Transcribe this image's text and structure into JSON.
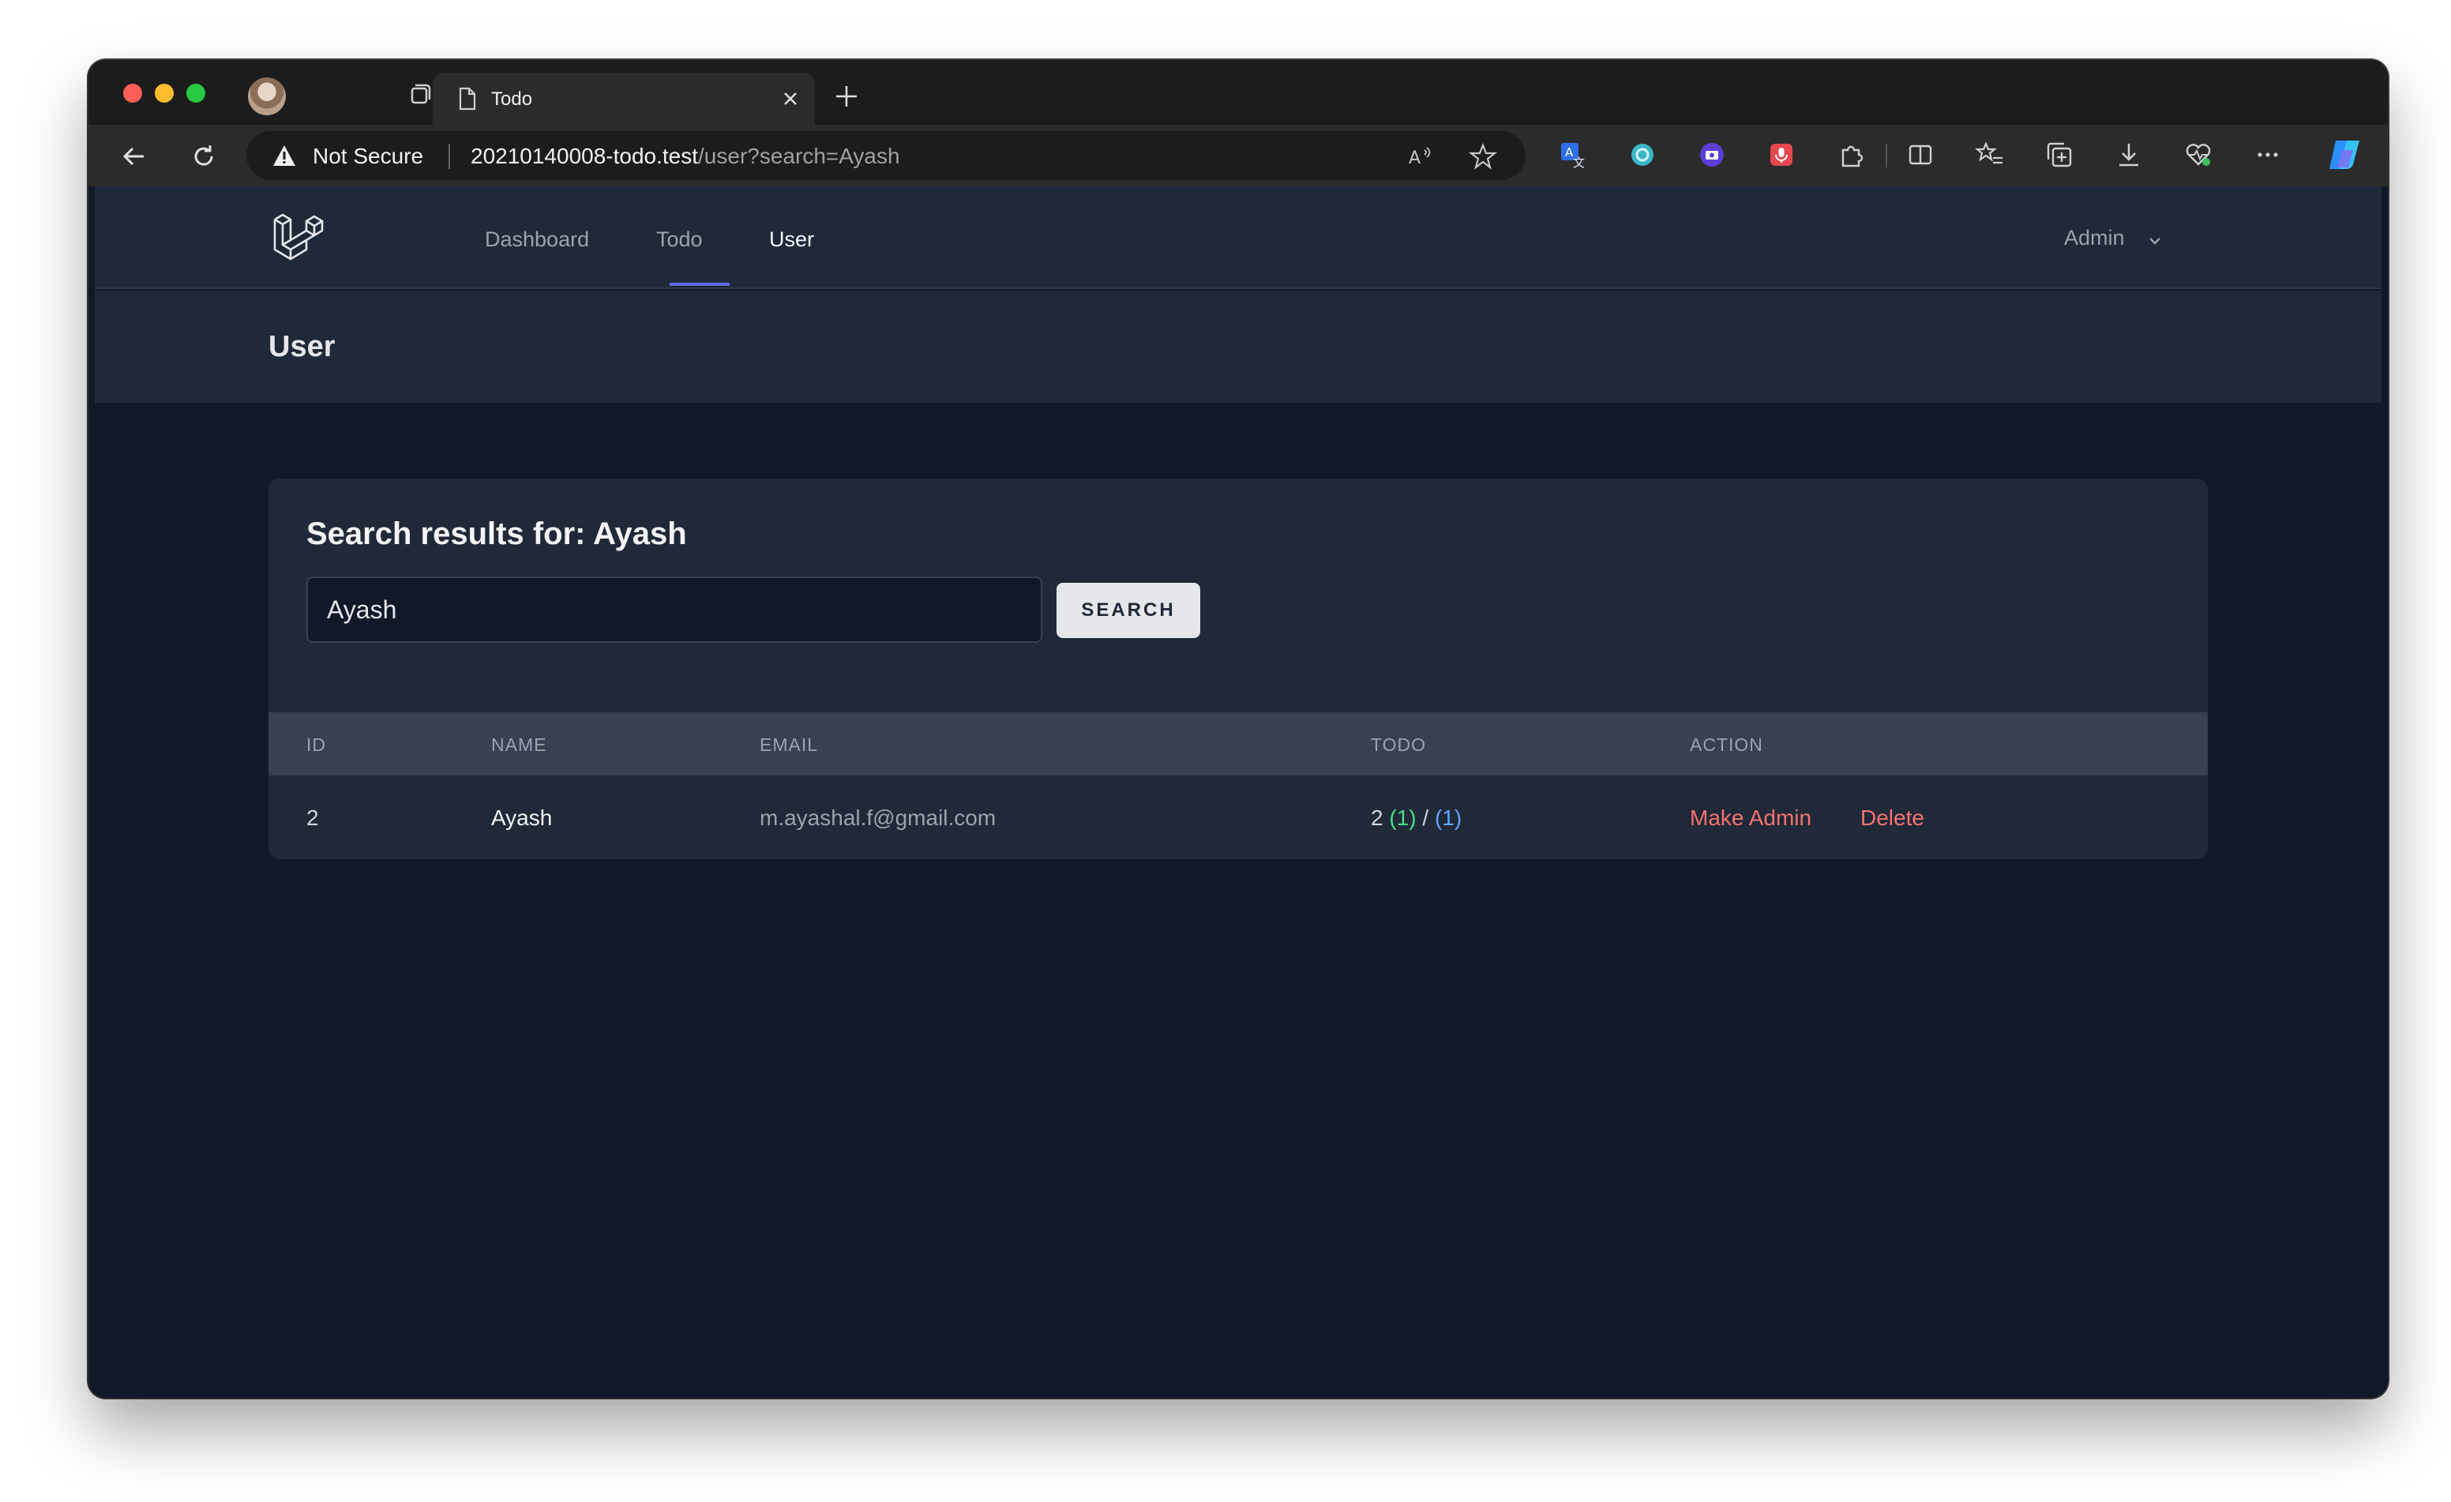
{
  "browser": {
    "tab": {
      "title": "Todo"
    },
    "address": {
      "security_label": "Not Secure",
      "host": "20210140008-todo.test",
      "path": "/user?search=Ayash"
    }
  },
  "app": {
    "nav": {
      "items": [
        {
          "label": "Dashboard",
          "active": false
        },
        {
          "label": "Todo",
          "active": false
        },
        {
          "label": "User",
          "active": true
        }
      ],
      "user_menu": "Admin"
    },
    "header": {
      "title": "User"
    },
    "search": {
      "heading": "Search results for: Ayash",
      "value": "Ayash",
      "button_label": "SEARCH"
    },
    "table": {
      "columns": [
        "ID",
        "NAME",
        "EMAIL",
        "TODO",
        "ACTION"
      ],
      "rows": [
        {
          "id": "2",
          "name": "Ayash",
          "email": "m.ayashal.f@gmail.com",
          "todo_total": "2",
          "todo_done": "(1)",
          "todo_sep": "/",
          "todo_pending": "(1)",
          "actions": [
            "Make Admin",
            "Delete"
          ]
        }
      ]
    }
  },
  "colors": {
    "accent": "#6366f1",
    "danger": "#f87171",
    "success": "#4ade80",
    "info": "#60a5fa",
    "page_bg": "#111827",
    "panel_bg": "#1f2937"
  }
}
